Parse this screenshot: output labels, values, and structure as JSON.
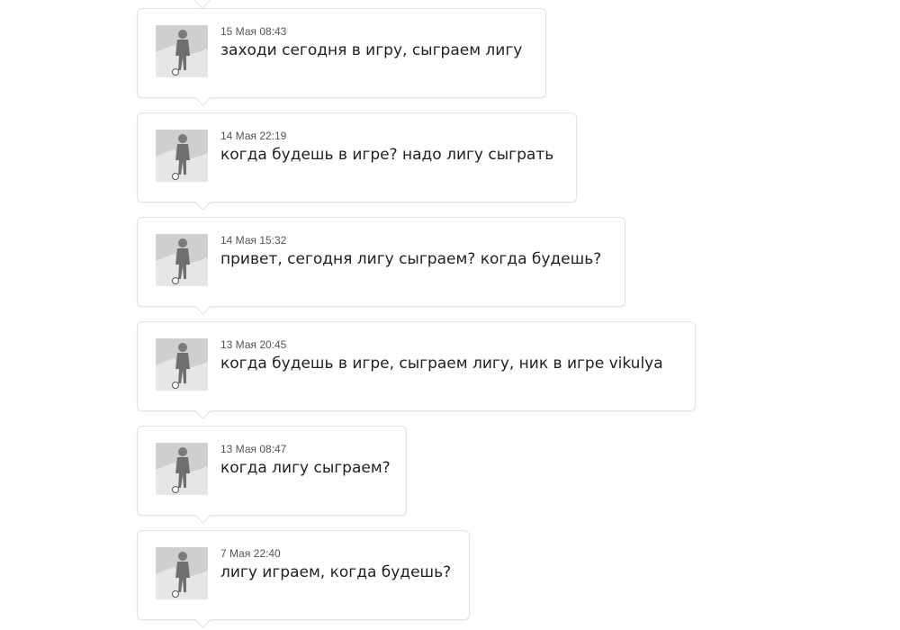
{
  "messages": [
    {
      "time": "15 Мая 08:43",
      "text": "заходи сегодня в игру, сыграем лигу"
    },
    {
      "time": "14 Мая 22:19",
      "text": "когда будешь в игре? надо лигу сыграть"
    },
    {
      "time": "14 Мая 15:32",
      "text": "привет, сегодня лигу сыграем? когда будешь?"
    },
    {
      "time": "13 Мая 20:45",
      "text": "когда будешь в игре, сыграем лигу, ник в игре vikulya"
    },
    {
      "time": "13 Мая 08:47",
      "text": "когда лигу сыграем?"
    },
    {
      "time": "7 Мая 22:40",
      "text": "лигу играем, когда будешь?"
    }
  ],
  "avatar_icon": "soccer-player-silhouette-icon",
  "colors": {
    "bubble_border": "#e3e3e3",
    "timestamp": "#555555",
    "message_text": "#222222",
    "avatar_bg": "#c9c9c9"
  }
}
